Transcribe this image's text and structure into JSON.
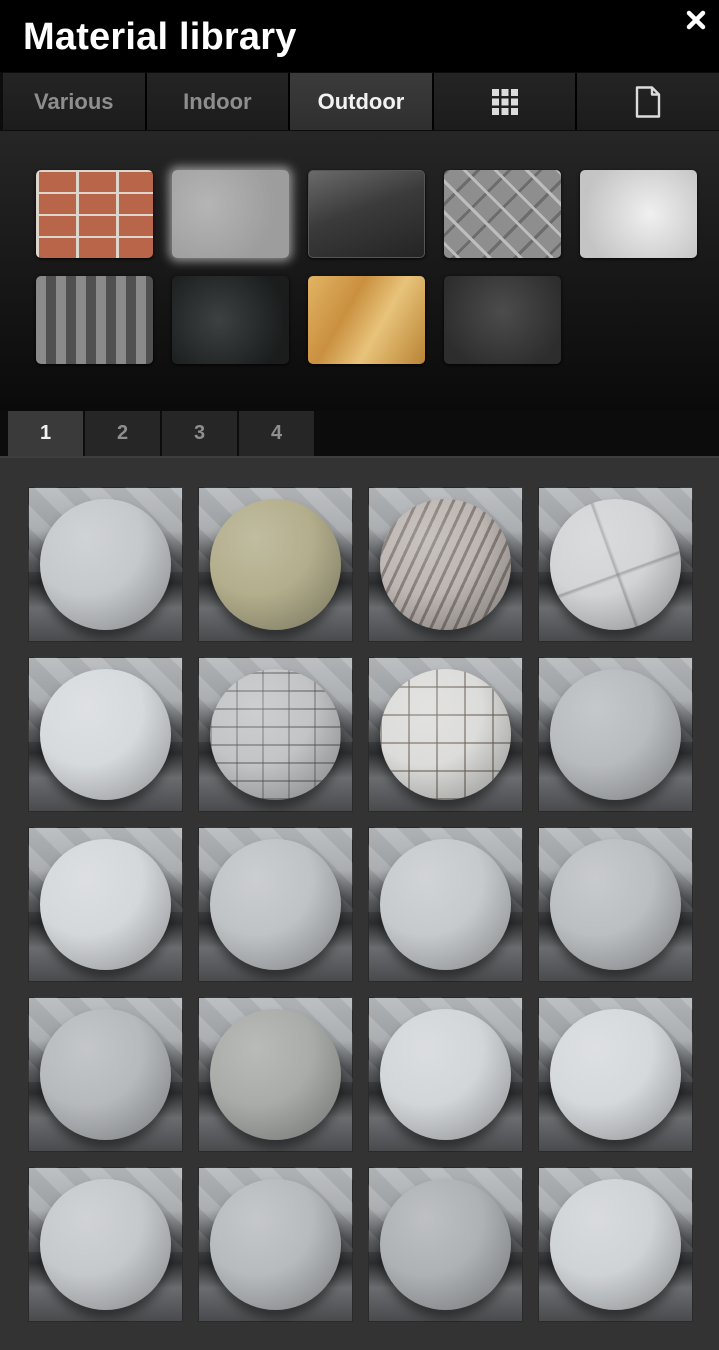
{
  "header": {
    "title": "Material library",
    "close_icon": "close-icon"
  },
  "category_tabs": [
    {
      "label": "Various",
      "active": false
    },
    {
      "label": "Indoor",
      "active": false
    },
    {
      "label": "Outdoor",
      "active": true
    },
    {
      "icon": "grid-icon",
      "active": false
    },
    {
      "icon": "document-icon",
      "active": false
    }
  ],
  "swatches": [
    {
      "name": "brick-texture",
      "style": "sw-brick",
      "selected": false
    },
    {
      "name": "concrete-texture",
      "style": "sw-concrete",
      "selected": true
    },
    {
      "name": "dark-glass-texture",
      "style": "sw-glass",
      "selected": false
    },
    {
      "name": "diamond-plate-texture",
      "style": "sw-plate",
      "selected": false
    },
    {
      "name": "white-plaster-texture",
      "style": "sw-plaster",
      "selected": false
    },
    {
      "name": "roof-tile-texture",
      "style": "sw-rooftile",
      "selected": false
    },
    {
      "name": "granite-texture",
      "style": "sw-granite",
      "selected": false
    },
    {
      "name": "osb-wood-texture",
      "style": "sw-osb",
      "selected": false
    },
    {
      "name": "asphalt-texture",
      "style": "sw-asphalt",
      "selected": false
    }
  ],
  "page_tabs": [
    {
      "label": "1",
      "active": true
    },
    {
      "label": "2",
      "active": false
    },
    {
      "label": "3",
      "active": false
    },
    {
      "label": "4",
      "active": false
    }
  ],
  "materials": [
    {
      "name": "material-sphere",
      "color": "#c6c9cc"
    },
    {
      "name": "material-sphere",
      "color": "#b3ae8c"
    },
    {
      "name": "material-sphere",
      "color": "#bdb6b2",
      "pattern": "stripes"
    },
    {
      "name": "material-sphere",
      "color": "#d2d4d6",
      "pattern": "cracked"
    },
    {
      "name": "material-sphere",
      "color": "#d7dadd"
    },
    {
      "name": "material-sphere",
      "color": "#c2c4c6",
      "pattern": "bricks"
    },
    {
      "name": "material-sphere",
      "color": "#dcdcda",
      "pattern": "tiles"
    },
    {
      "name": "material-sphere",
      "color": "#b9bcbf"
    },
    {
      "name": "material-sphere",
      "color": "#d5d8db"
    },
    {
      "name": "material-sphere",
      "color": "#c0c3c6"
    },
    {
      "name": "material-sphere",
      "color": "#c7cacd"
    },
    {
      "name": "material-sphere",
      "color": "#bcbfc2"
    },
    {
      "name": "material-sphere",
      "color": "#b7babd"
    },
    {
      "name": "material-sphere",
      "color": "#a9aca9"
    },
    {
      "name": "material-sphere",
      "color": "#d3d6d9"
    },
    {
      "name": "material-sphere",
      "color": "#d6d9dc"
    },
    {
      "name": "material-sphere",
      "color": "#c6c9cc"
    },
    {
      "name": "material-sphere",
      "color": "#b8bbbe"
    },
    {
      "name": "material-sphere",
      "color": "#afb2b5"
    },
    {
      "name": "material-sphere",
      "color": "#d0d3d6"
    }
  ]
}
